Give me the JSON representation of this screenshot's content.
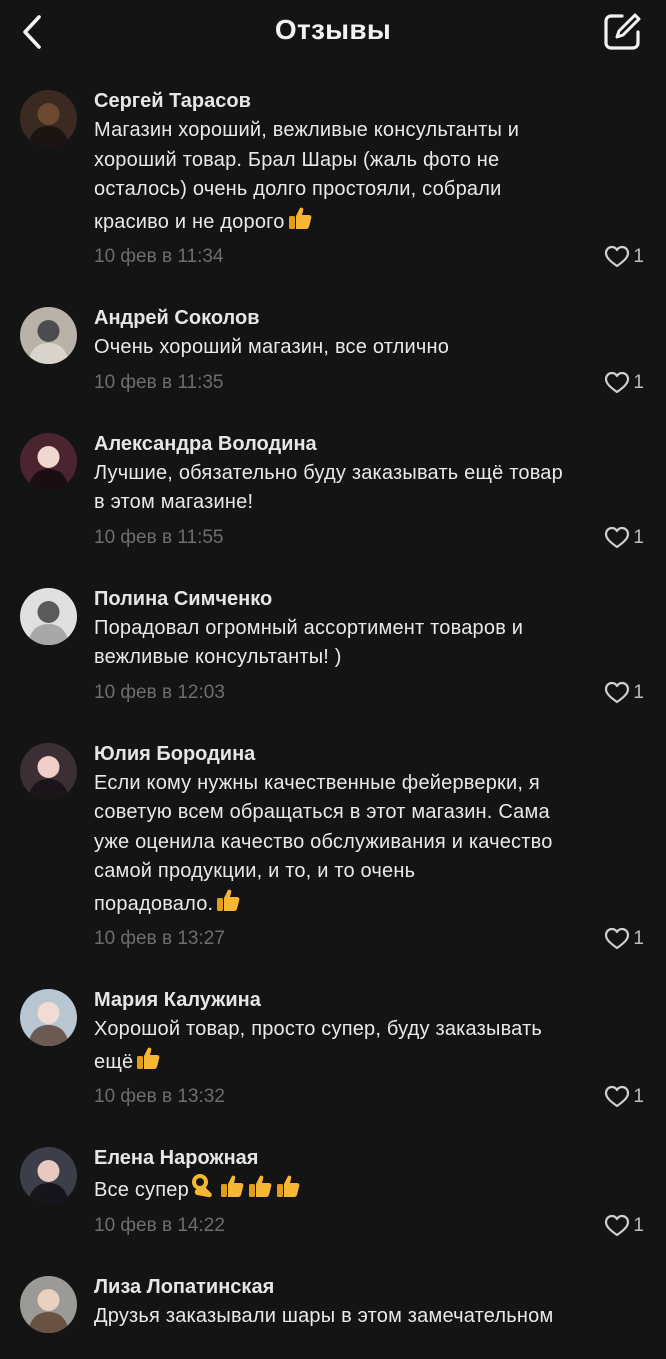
{
  "header": {
    "title": "Отзывы",
    "back_icon": "chevron-left-icon",
    "compose_icon": "edit-icon"
  },
  "colors": {
    "background": "#141414",
    "text": "#e9e9e9",
    "date": "#6d6d6d"
  },
  "reviews": [
    {
      "author": "Сергей Тарасов",
      "text": "Магазин хороший, вежливые консультанты и\nхороший товар. Брал Шары (жаль фото не\nосталось) очень долго простояли, собрали\nкрасиво и не дорого",
      "emoji": "👍",
      "date": "10 фев в 11:34",
      "likes": "1"
    },
    {
      "author": "Андрей Соколов",
      "text": "Очень хороший магазин, все отлично",
      "emoji": "",
      "date": "10 фев в 11:35",
      "likes": "1"
    },
    {
      "author": "Александра Володина",
      "text": "Лучшие, обязательно буду заказывать ещё товар\nв этом магазине!",
      "emoji": "",
      "date": "10 фев в 11:55",
      "likes": "1"
    },
    {
      "author": "Полина Симченко",
      "text": "Порадовал огромный ассортимент товаров и\nвежливые консультанты! )",
      "emoji": "",
      "date": "10 фев в 12:03",
      "likes": "1"
    },
    {
      "author": "Юлия Бородина",
      "text": "Если кому нужны качественные фейерверки, я\nсоветую всем обращаться в этот магазин. Сама\nуже оценила качество обслуживания и качество\nсамой продукции, и то, и то очень\nпорадовало.",
      "emoji": "👍",
      "date": "10 фев в 13:27",
      "likes": "1"
    },
    {
      "author": "Мария Калужина",
      "text": "Хорошой товар, просто супер, буду заказывать\nещё",
      "emoji": "👍",
      "date": "10 фев в 13:32",
      "likes": "1"
    },
    {
      "author": "Елена Нарожная",
      "text": "Все супер",
      "emoji": "👌👍👍👍",
      "date": "10 фев в 14:22",
      "likes": "1"
    },
    {
      "author": "Лиза Лопатинская",
      "text": "Друзья заказывали шары в этом замечательном",
      "emoji": "",
      "date": "",
      "likes": ""
    }
  ]
}
